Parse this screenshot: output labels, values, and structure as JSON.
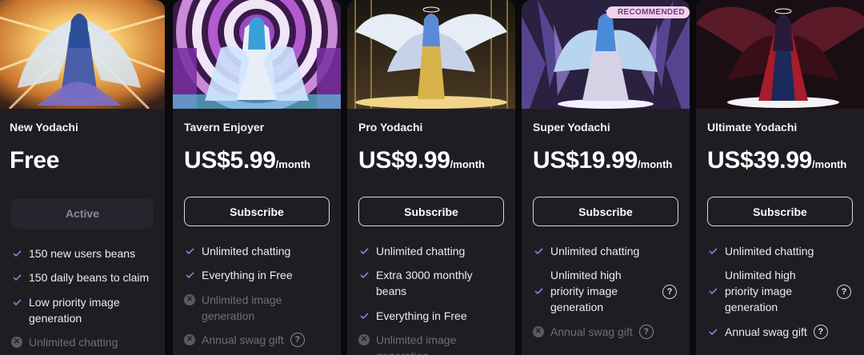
{
  "plans": [
    {
      "name": "New Yodachi",
      "price": "Free",
      "period": "",
      "button": "Active",
      "button_state": "active",
      "features": [
        {
          "text": "150 new users beans",
          "included": true
        },
        {
          "text": "150 daily beans to claim",
          "included": true
        },
        {
          "text": "Low priority image generation",
          "included": true
        },
        {
          "text": "Unlimited chatting",
          "included": false
        }
      ]
    },
    {
      "name": "Tavern Enjoyer",
      "price": "US$5.99",
      "period": "/month",
      "button": "Subscribe",
      "button_state": "default",
      "features": [
        {
          "text": "Unlimited chatting",
          "included": true
        },
        {
          "text": "Everything in Free",
          "included": true
        },
        {
          "text": "Unlimited image generation",
          "included": false
        },
        {
          "text": "Annual swag gift",
          "included": false,
          "help": "?"
        }
      ]
    },
    {
      "name": "Pro Yodachi",
      "price": "US$9.99",
      "period": "/month",
      "button": "Subscribe",
      "button_state": "default",
      "features": [
        {
          "text": "Unlimited chatting",
          "included": true
        },
        {
          "text": "Extra 3000 monthly beans",
          "included": true
        },
        {
          "text": "Everything in Free",
          "included": true
        },
        {
          "text": "Unlimited image generation",
          "included": false
        }
      ]
    },
    {
      "name": "Super Yodachi",
      "price": "US$19.99",
      "period": "/month",
      "button": "Subscribe",
      "button_state": "default",
      "badge": "RECOMMENDED",
      "features": [
        {
          "text": "Unlimited chatting",
          "included": true
        },
        {
          "text": "Unlimited high priority image generation",
          "included": true,
          "help": "?"
        },
        {
          "text": "Annual swag gift",
          "included": false,
          "help": "?"
        }
      ]
    },
    {
      "name": "Ultimate Yodachi",
      "price": "US$39.99",
      "period": "/month",
      "button": "Subscribe",
      "button_state": "default",
      "features": [
        {
          "text": "Unlimited chatting",
          "included": true
        },
        {
          "text": "Unlimited high priority image generation",
          "included": true,
          "help": "?"
        },
        {
          "text": "Annual swag gift",
          "included": true,
          "help": "?"
        }
      ]
    }
  ],
  "colors": {
    "page_bg": "#0a0a0c",
    "card_bg": "#1e1e22",
    "check": "#8b7fd8",
    "muted": "#6e6e76",
    "badge_bg": "#f3d2ee",
    "badge_text": "#6a3f76"
  },
  "icons": {
    "included": "check-icon",
    "excluded": "x-circle-icon",
    "help": "question-circle-icon",
    "badge": "sparkle-icon"
  }
}
